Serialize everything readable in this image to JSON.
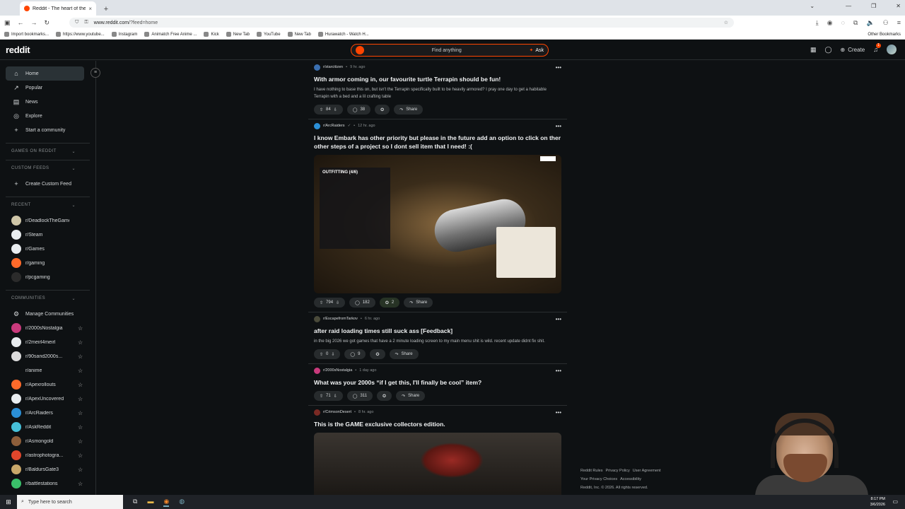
{
  "browser": {
    "tab_title": "Reddit - The heart of the intern",
    "new_tab": "+",
    "close": "×",
    "url_host": "www.reddit.com",
    "url_path": "/?feed=home",
    "bookmarks": [
      "Import bookmarks...",
      "https://www.youtube...",
      "Instagram",
      "Animatch Free Anime ...",
      "Kick",
      "New Tab",
      "YouTube",
      "New Tab",
      "Hurawatch - Watch H..."
    ],
    "other_bookmarks": "Other Bookmarks"
  },
  "reddit_header": {
    "logo": "reddit",
    "search_placeholder": "Find anything",
    "ask_label": "Ask",
    "create_label": "Create",
    "notification_count": "1"
  },
  "sidebar": {
    "nav": [
      {
        "label": "Home",
        "icon": "home-icon",
        "active": true
      },
      {
        "label": "Popular",
        "icon": "popular-icon"
      },
      {
        "label": "News",
        "icon": "news-icon"
      },
      {
        "label": "Explore",
        "icon": "explore-icon"
      },
      {
        "label": "Start a community",
        "icon": "plus-icon"
      }
    ],
    "games_heading": "GAMES ON REDDIT",
    "custom_feeds_heading": "CUSTOM FEEDS",
    "create_custom_feed": "Create Custom Feed",
    "recent_heading": "RECENT",
    "recent": [
      {
        "name": "r/DeadlockTheGame",
        "color": "#cfc6a8"
      },
      {
        "name": "r/Steam",
        "color": "#e8ecef"
      },
      {
        "name": "r/Games",
        "color": "#e8ecef"
      },
      {
        "name": "r/gaming",
        "color": "#ff6a2a"
      },
      {
        "name": "r/pcgaming",
        "color": "#2b2b2b"
      }
    ],
    "communities_heading": "COMMUNITIES",
    "manage_communities": "Manage Communities",
    "communities": [
      {
        "name": "r/2000sNostalgia",
        "color": "#c93a7c"
      },
      {
        "name": "r/2meirl4meirl",
        "color": "#e8ecef"
      },
      {
        "name": "r/90sand2000s...",
        "color": "#dcdcdc"
      },
      {
        "name": "r/anime",
        "color": "#0e1113"
      },
      {
        "name": "r/Apexrollouts",
        "color": "#ff6a2a"
      },
      {
        "name": "r/ApexUncovered",
        "color": "#e8ecef"
      },
      {
        "name": "r/ArcRaiders",
        "color": "#2b8fd6"
      },
      {
        "name": "r/AskReddit",
        "color": "#46c0d9"
      },
      {
        "name": "r/Asmongold",
        "color": "#8d5e3a"
      },
      {
        "name": "r/astrophotogra...",
        "color": "#e0462c"
      },
      {
        "name": "r/BaldursGate3",
        "color": "#c9a86a"
      },
      {
        "name": "r/battlestations",
        "color": "#3ac06a"
      }
    ]
  },
  "posts": [
    {
      "sub": "r/starcitizen",
      "time": "9 hr. ago",
      "sub_color": "#3a6fb0",
      "title": "With armor coming in, our favourite turtle Terrapin should be fun!",
      "body": "I have nothing to base this on, but isn't the Terrapin specifically built to be heavily armored? I pray one day to get a habitable Terrapin with a bed and a lil crafting table",
      "votes": "84",
      "comments": "38",
      "share": "Share"
    },
    {
      "sub": "r/ArcRaiders",
      "time": "12 hr. ago",
      "sub_color": "#2b8fd6",
      "title": "I know Embark has other priority but please in the future add an option to click on ther other steps of a project so I dont sell item that I need! :(",
      "image_heading": "OUTFITTING (4/6)",
      "votes": "794",
      "comments": "182",
      "awards": "2",
      "share": "Share"
    },
    {
      "sub": "r/EscapefromTarkov",
      "time": "6 hr. ago",
      "sub_color": "#4a4a3a",
      "title": "after raid loading times still suck ass [Feedback]",
      "body": "in the big 2026 we got games that have a 2 minute loading screen to my main menu shit is wild. recent update didnt fix shit.",
      "votes": "0",
      "comments": "9",
      "share": "Share"
    },
    {
      "sub": "r/2000sNostalgia",
      "time": "1 day ago",
      "sub_color": "#c93a7c",
      "title": "What was your 2000s “if I get this, I'll finally be cool” item?",
      "votes": "71",
      "comments": "311",
      "share": "Share"
    },
    {
      "sub": "r/CrimsonDesert",
      "time": "8 hr. ago",
      "sub_color": "#7a2a24",
      "title": "This is the GAME exclusive collectors edition."
    }
  ],
  "footer": {
    "links": [
      "Reddit Rules",
      "Privacy Policy",
      "User Agreement",
      "Your Privacy Choices",
      "Accessibility"
    ],
    "copyright": "Reddit, Inc. © 2026. All rights reserved."
  },
  "taskbar": {
    "search_placeholder": "Type here to search",
    "time": "8:17 PM",
    "date": "3/6/2026"
  }
}
